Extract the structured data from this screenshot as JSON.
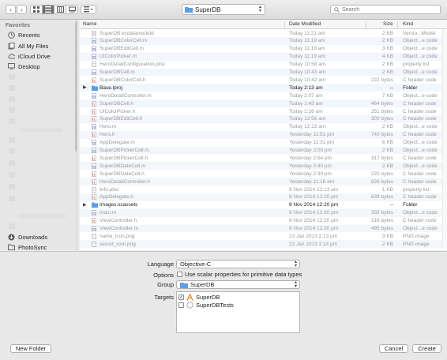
{
  "toolbar": {
    "path_folder": "SuperDB",
    "search_placeholder": "Search"
  },
  "sidebar": {
    "favorites_heading": "Favorites",
    "items": [
      {
        "label": "Recents",
        "icon": "clock-icon"
      },
      {
        "label": "All My Files",
        "icon": "all-files-icon"
      },
      {
        "label": "iCloud Drive",
        "icon": "cloud-icon"
      },
      {
        "label": "Desktop",
        "icon": "desktop-icon"
      }
    ],
    "bottom_items": [
      {
        "label": "Downloads",
        "icon": "downloads-icon"
      },
      {
        "label": "PhotoSync",
        "icon": "folder-icon"
      }
    ]
  },
  "file_list": {
    "columns": {
      "name": "Name",
      "date": "Date Modified",
      "size": "Size",
      "kind": "Kind"
    },
    "rows": [
      {
        "name": "SuperDB.xcdatamodeld",
        "date": "Today 11:21 am",
        "size": "2 KB",
        "kind": "Versio...Model",
        "icon": "data-model",
        "dark": false,
        "folder": false
      },
      {
        "name": "SuperDBColorCell.m",
        "date": "Today 11:19 am",
        "size": "2 KB",
        "kind": "Object...e code",
        "icon": "m",
        "dark": false,
        "folder": false
      },
      {
        "name": "SuperDBEditCell.m",
        "date": "Today 11:19 am",
        "size": "3 KB",
        "kind": "Object...e code",
        "icon": "m",
        "dark": false,
        "folder": false
      },
      {
        "name": "UIColorPicker.m",
        "date": "Today 11:19 am",
        "size": "4 KB",
        "kind": "Object...e code",
        "icon": "m",
        "dark": false,
        "folder": false
      },
      {
        "name": "HeroDetailConfiguration.plist",
        "date": "Today 10:58 am",
        "size": "2 KB",
        "kind": "property list",
        "icon": "plist",
        "dark": false,
        "folder": false
      },
      {
        "name": "SuperDBCell.m",
        "date": "Today 10:43 am",
        "size": "2 KB",
        "kind": "Object...e code",
        "icon": "m",
        "dark": false,
        "folder": false
      },
      {
        "name": "SuperDBColorCell.h",
        "date": "Today 10:42 am",
        "size": "222 bytes",
        "kind": "C header code",
        "icon": "h",
        "dark": false,
        "folder": false
      },
      {
        "name": "Base.lproj",
        "date": "Today 2:13 am",
        "size": "--",
        "kind": "Folder",
        "icon": "folder",
        "dark": true,
        "folder": true
      },
      {
        "name": "HeroDetailController.m",
        "date": "Today 2:07 am",
        "size": "7 KB",
        "kind": "Object...e code",
        "icon": "m",
        "dark": false,
        "folder": false
      },
      {
        "name": "SuperDBCell.h",
        "date": "Today 1:43 am",
        "size": "464 bytes",
        "kind": "C header code",
        "icon": "h",
        "dark": false,
        "folder": false
      },
      {
        "name": "UIColorPicker.h",
        "date": "Today 1:16 am",
        "size": "251 bytes",
        "kind": "C header code",
        "icon": "h",
        "dark": false,
        "folder": false
      },
      {
        "name": "SuperDBEditCell.h",
        "date": "Today 12:56 am",
        "size": "300 bytes",
        "kind": "C header code",
        "icon": "h",
        "dark": false,
        "folder": false
      },
      {
        "name": "Hero.m",
        "date": "Today 12:13 am",
        "size": "2 KB",
        "kind": "Object...e code",
        "icon": "m",
        "dark": false,
        "folder": false
      },
      {
        "name": "Hero.h",
        "date": "Yesterday 11:51 pm",
        "size": "740 bytes",
        "kind": "C header code",
        "icon": "h",
        "dark": false,
        "folder": false
      },
      {
        "name": "AppDelegate.m",
        "date": "Yesterday 11:31 pm",
        "size": "6 KB",
        "kind": "Object...e code",
        "icon": "m",
        "dark": false,
        "folder": false
      },
      {
        "name": "SuperDBPickerCell.m",
        "date": "Yesterday 3:00 pm",
        "size": "2 KB",
        "kind": "Object...e code",
        "icon": "m",
        "dark": false,
        "folder": false
      },
      {
        "name": "SuperDBPickerCell.h",
        "date": "Yesterday 2:54 pm",
        "size": "317 bytes",
        "kind": "C header code",
        "icon": "h",
        "dark": false,
        "folder": false
      },
      {
        "name": "SuperDBDateCell.m",
        "date": "Yesterday 2:40 pm",
        "size": "2 KB",
        "kind": "Object...e code",
        "icon": "m",
        "dark": false,
        "folder": false
      },
      {
        "name": "SuperDBDateCell.h",
        "date": "Yesterday 2:30 pm",
        "size": "220 bytes",
        "kind": "C header code",
        "icon": "h",
        "dark": false,
        "folder": false
      },
      {
        "name": "HeroDetailController.h",
        "date": "Yesterday 11:16 am",
        "size": "826 bytes",
        "kind": "C header code",
        "icon": "h",
        "dark": false,
        "folder": false
      },
      {
        "name": "Info.plist",
        "date": "9 Nov 2014 12:13 am",
        "size": "1 KB",
        "kind": "property list",
        "icon": "plist",
        "dark": false,
        "folder": false
      },
      {
        "name": "AppDelegate.h",
        "date": "8 Nov 2014 12:20 pm",
        "size": "639 bytes",
        "kind": "C header code",
        "icon": "h",
        "dark": false,
        "folder": false
      },
      {
        "name": "Images.xcassets",
        "date": "8 Nov 2014 12:20 pm",
        "size": "--",
        "kind": "Folder",
        "icon": "folder",
        "dark": true,
        "folder": true
      },
      {
        "name": "main.m",
        "date": "8 Nov 2014 12:20 pm",
        "size": "335 bytes",
        "kind": "Object...e code",
        "icon": "m",
        "dark": false,
        "folder": false
      },
      {
        "name": "ViewController.h",
        "date": "8 Nov 2014 12:20 pm",
        "size": "216 bytes",
        "kind": "C header code",
        "icon": "h",
        "dark": false,
        "folder": false
      },
      {
        "name": "ViewController.m",
        "date": "8 Nov 2014 12:20 pm",
        "size": "495 bytes",
        "kind": "Object...e code",
        "icon": "m",
        "dark": false,
        "folder": false
      },
      {
        "name": "name_icon.png",
        "date": "23 Jan 2013 2:13 pm",
        "size": "3 KB",
        "kind": "PNG image",
        "icon": "png",
        "dark": false,
        "folder": false
      },
      {
        "name": "secret_icon.png",
        "date": "23 Jan 2013 2:14 pm",
        "size": "2 KB",
        "kind": "PNG image",
        "icon": "png",
        "dark": false,
        "folder": false
      }
    ]
  },
  "options": {
    "language_label": "Language",
    "language_value": "Objective-C",
    "options_label": "Options",
    "scalar_checkbox_label": "Use scalar properties for primitive data types",
    "scalar_checked": false,
    "group_label": "Group",
    "group_value": "SuperDB",
    "targets_label": "Targets",
    "targets": [
      {
        "name": "SuperDB",
        "checked": true
      },
      {
        "name": "SuperDBTests",
        "checked": false
      }
    ]
  },
  "buttons": {
    "new_folder": "New Folder",
    "cancel": "Cancel",
    "create": "Create"
  },
  "colors": {
    "folder_blue": "#5a9fe6",
    "selection_gray": "#6b6b6b"
  }
}
